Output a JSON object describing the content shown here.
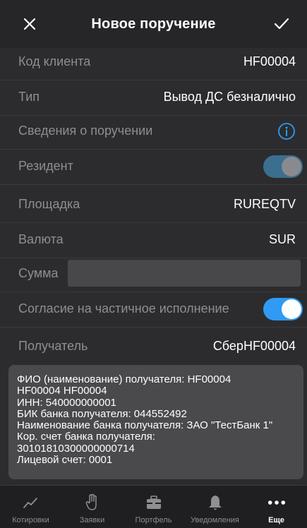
{
  "header": {
    "title": "Новое поручение",
    "close_icon": "close-icon",
    "confirm_icon": "checkmark-icon"
  },
  "form": {
    "client_code": {
      "label": "Код клиента",
      "value": "HF00004"
    },
    "type": {
      "label": "Тип",
      "value": "Вывод ДС безналично"
    },
    "order_info": {
      "label": "Сведения о поручении",
      "icon": "info-icon"
    },
    "resident": {
      "label": "Резидент",
      "checked": true
    },
    "venue": {
      "label": "Площадка",
      "value": "RUREQTV"
    },
    "currency": {
      "label": "Валюта",
      "value": "SUR"
    },
    "amount": {
      "label": "Сумма",
      "value": ""
    },
    "partial_execution": {
      "label": "Согласие на частичное исполнение",
      "checked": true
    },
    "recipient": {
      "label": "Получатель",
      "value": "СберHF00004"
    }
  },
  "details": {
    "lines": [
      "ФИО (наименование) получателя: HF00004",
      "HF00004 HF00004",
      "ИНН: 540000000001",
      "БИК банка получателя: 044552492",
      "Наименование банка получателя: ЗАО \"ТестБанк 1\"",
      "Кор. счет банка получателя:",
      "30101810300000000714",
      "Лицевой счет: 0001"
    ]
  },
  "tabbar": {
    "tabs": [
      {
        "label": "Котировки",
        "icon": "chart-line-icon"
      },
      {
        "label": "Заявки",
        "icon": "hand-icon"
      },
      {
        "label": "Портфель",
        "icon": "briefcase-icon"
      },
      {
        "label": "Уведомления",
        "icon": "bell-icon"
      },
      {
        "label": "Еще",
        "icon": "more-dots-icon"
      }
    ],
    "active_index": 4
  },
  "colors": {
    "background": "#2c2c2e",
    "accent": "#2f9bf4",
    "muted_text": "#8e8e93"
  }
}
